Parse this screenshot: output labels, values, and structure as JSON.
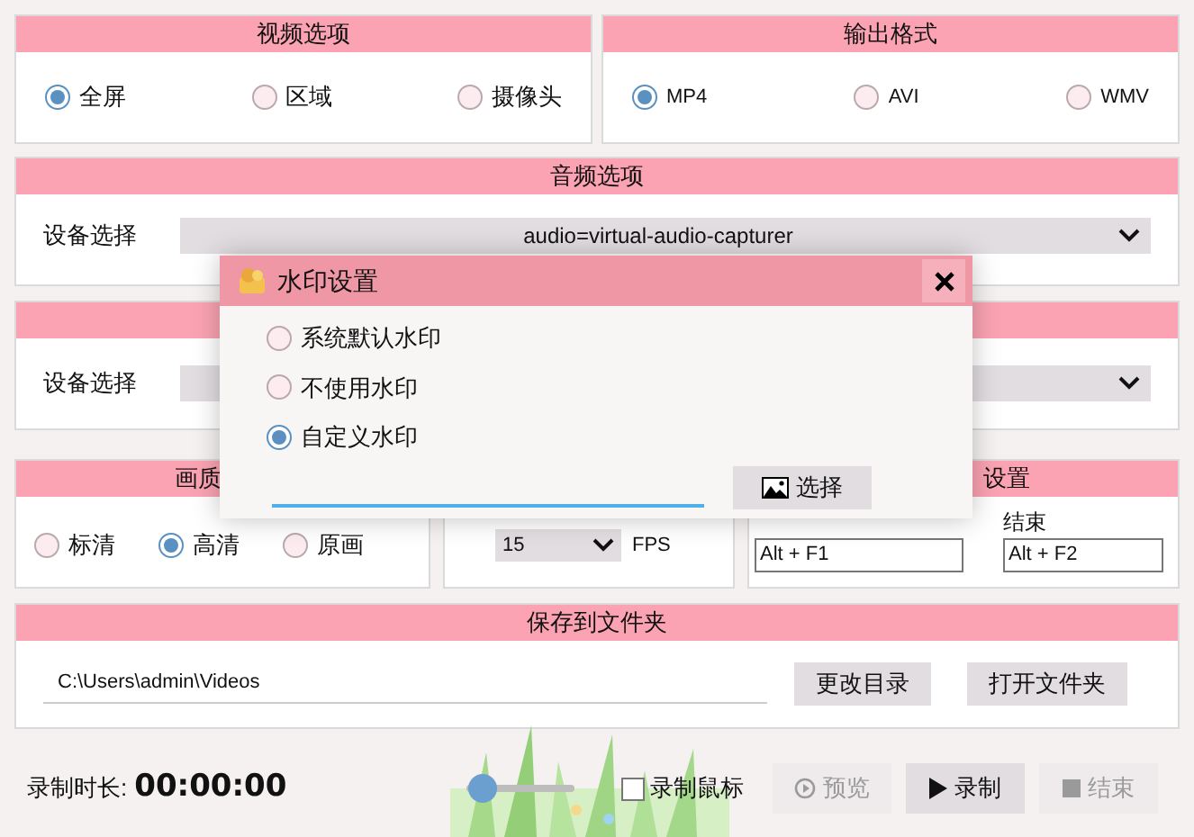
{
  "video_options": {
    "title": "视频选项",
    "options": [
      {
        "label": "全屏",
        "selected": true
      },
      {
        "label": "区域",
        "selected": false
      },
      {
        "label": "摄像头",
        "selected": false
      }
    ]
  },
  "output_format": {
    "title": "输出格式",
    "options": [
      {
        "label": "MP4",
        "selected": true
      },
      {
        "label": "AVI",
        "selected": false
      },
      {
        "label": "WMV",
        "selected": false
      }
    ]
  },
  "audio_options": {
    "title": "音频选项",
    "device_label": "设备选择",
    "device_value": "audio=virtual-audio-capturer"
  },
  "video_device": {
    "device_label": "设备选择"
  },
  "quality": {
    "title": "画质",
    "options": [
      {
        "label": "标清",
        "selected": false
      },
      {
        "label": "高清",
        "selected": true
      },
      {
        "label": "原画",
        "selected": false
      }
    ]
  },
  "frame_rate": {
    "value": "15",
    "unit": "FPS"
  },
  "hotkeys": {
    "title": "设置",
    "end_label": "结束",
    "start_value": "Alt + F1",
    "end_value": "Alt + F2"
  },
  "save_folder": {
    "title": "保存到文件夹",
    "path": "C:\\Users\\admin\\Videos",
    "buttons": [
      "更改目录",
      "打开文件夹"
    ]
  },
  "recorder": {
    "duration_label": "录制时长:",
    "duration": "00:00:00",
    "volume": {
      "level": 0.02
    },
    "record_mouse": {
      "label": "录制鼠标",
      "checked": false
    },
    "buttons": [
      {
        "label": "预览",
        "kind": "preview",
        "disabled": true
      },
      {
        "label": "录制",
        "kind": "record",
        "disabled": false
      },
      {
        "label": "结束",
        "kind": "stop",
        "disabled": true
      }
    ]
  },
  "dialog": {
    "title": "水印设置",
    "options": [
      {
        "label": "系统默认水印",
        "selected": false
      },
      {
        "label": "不使用水印",
        "selected": false
      },
      {
        "label": "自定义水印",
        "selected": true
      }
    ],
    "button": "选择"
  }
}
